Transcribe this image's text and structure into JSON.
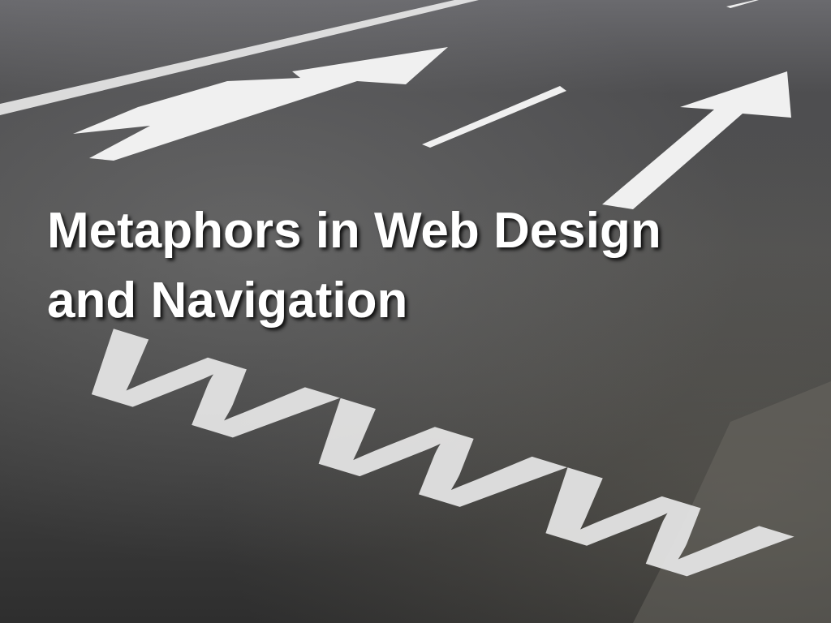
{
  "slide": {
    "title_line1": "Metaphors in Web Design",
    "title_line2": "and Navigation"
  },
  "background": {
    "road_marking_text": "WWW",
    "asphalt_color": "#4a4a4a",
    "paint_color": "#f2f2f2"
  }
}
